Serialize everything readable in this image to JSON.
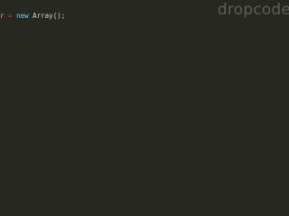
{
  "editor": {
    "background": "#272822",
    "code_line": {
      "tokens": {
        "variable": "r",
        "space1": " ",
        "operator": "=",
        "space2": " ",
        "keyword": "new",
        "rest": " Array();"
      },
      "colors": {
        "variable": "#e6b85c",
        "operator": "#f92672",
        "keyword": "#66d9ef",
        "plain": "#d6d6cf"
      }
    }
  },
  "watermark": {
    "text": "dropcode",
    "color": "#5d5e59"
  }
}
